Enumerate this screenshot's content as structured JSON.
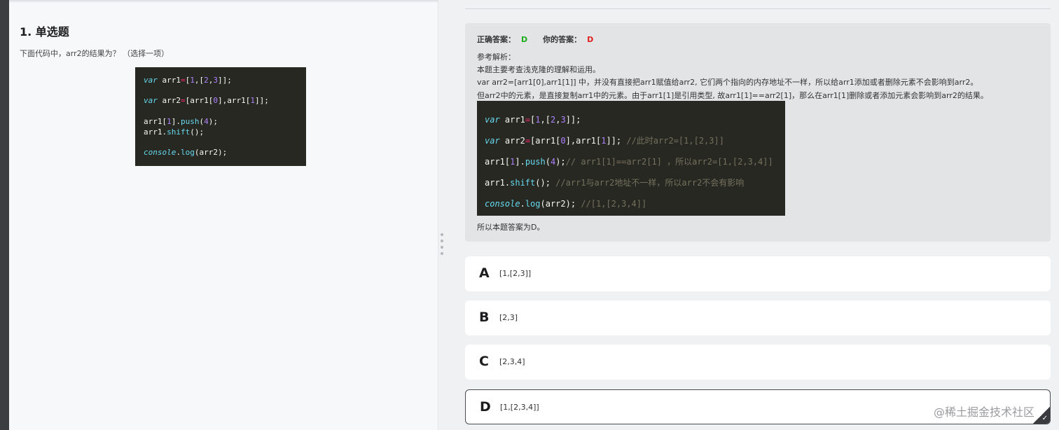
{
  "question": {
    "title": "1. 单选题",
    "text": "下面代码中，arr2的结果为？ （选择一项）"
  },
  "code_left": {
    "lines": [
      "var arr1=[1,[2,3]];",
      "",
      "var arr2=[arr1[0],arr1[1]];",
      "",
      "arr1[1].push(4);",
      "arr1.shift();",
      "",
      "console.log(arr2);"
    ]
  },
  "analysis": {
    "correct_label": "正确答案：",
    "correct_value": "D",
    "yours_label": "你的答案：",
    "yours_value": "D",
    "explanation_label": "参考解析：",
    "lines": [
      "本题主要考查浅克隆的理解和运用。",
      "var arr2=[arr1[0],arr1[1]] 中，并没有直接把arr1赋值给arr2, 它们两个指向的内存地址不一样，所以给arr1添加或者删除元素不会影响到arr2。",
      "但arr2中的元素，是直接复制arr1中的元素。由于arr1[1]是引用类型, 故arr1[1]==arr2[1]，那么在arr1[1]删除或者添加元素会影响到arr2的结果。"
    ],
    "code_lines": [
      "var arr1=[1,[2,3]];",
      "var arr2=[arr1[0],arr1[1]]; //此时arr2=[1,[2,3]]",
      "arr1[1].push(4);// arr1[1]==arr2[1] ，所以arr2=[1,[2,3,4]]",
      "arr1.shift(); //arr1与arr2地址不一样，所以arr2不会有影响",
      "console.log(arr2); //[1,[2,3,4]]"
    ],
    "conclusion": "所以本题答案为D。"
  },
  "options": [
    {
      "letter": "A",
      "text": "[1,[2,3]]"
    },
    {
      "letter": "B",
      "text": "[2,3]"
    },
    {
      "letter": "C",
      "text": "[2,3,4]"
    },
    {
      "letter": "D",
      "text": "[1,[2,3,4]]"
    }
  ],
  "selected_option": "D",
  "watermark": "@稀土掘金技术社区",
  "colors": {
    "correct": "#1aad19",
    "wrong": "#e02020",
    "code_bg": "#272822"
  }
}
